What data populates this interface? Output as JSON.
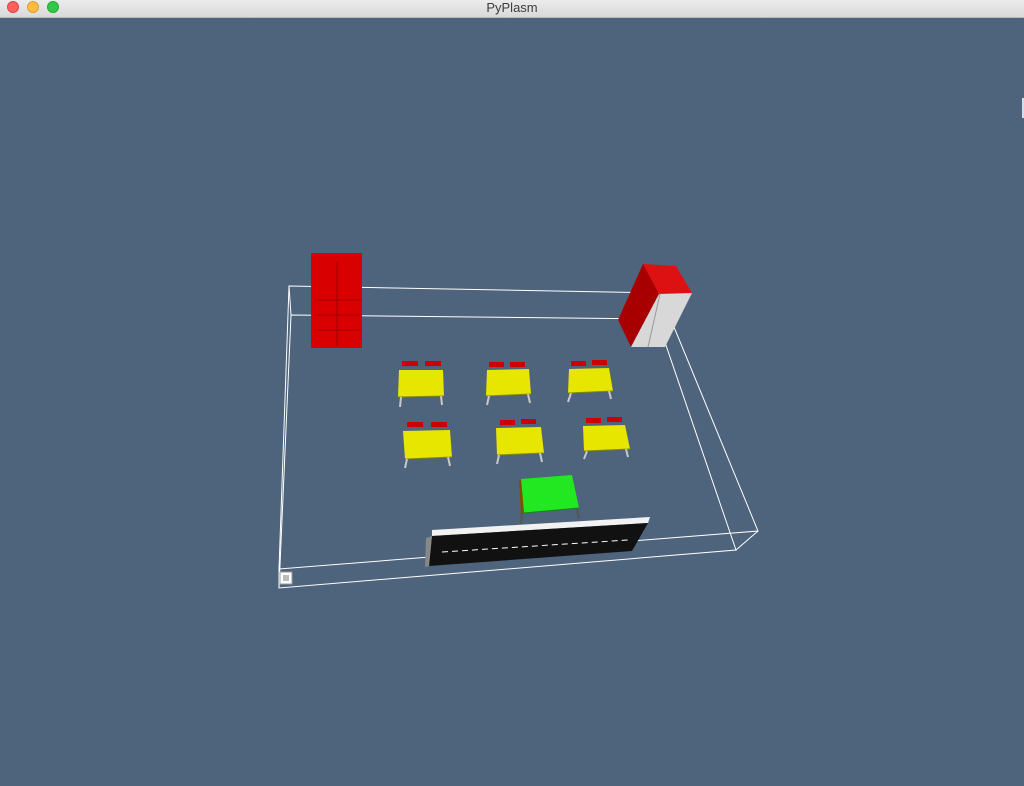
{
  "window": {
    "title": "PyPlasm",
    "controls": [
      "close-icon",
      "minimize-icon",
      "zoom-icon"
    ]
  },
  "scene": {
    "background_color": "#4d647c",
    "room_outline_color": "#ffffff",
    "objects": [
      {
        "name": "left-red-cabinet",
        "color": "#d80000"
      },
      {
        "name": "right-red-cabinet",
        "color": "#cc0000"
      },
      {
        "name": "student-desks",
        "color": "#e6e600",
        "count": 6
      },
      {
        "name": "student-chairs",
        "color": "#cc0000",
        "count": 12
      },
      {
        "name": "teacher-desk",
        "color": "#22e822"
      },
      {
        "name": "blackboard",
        "color": "#111111"
      }
    ]
  }
}
